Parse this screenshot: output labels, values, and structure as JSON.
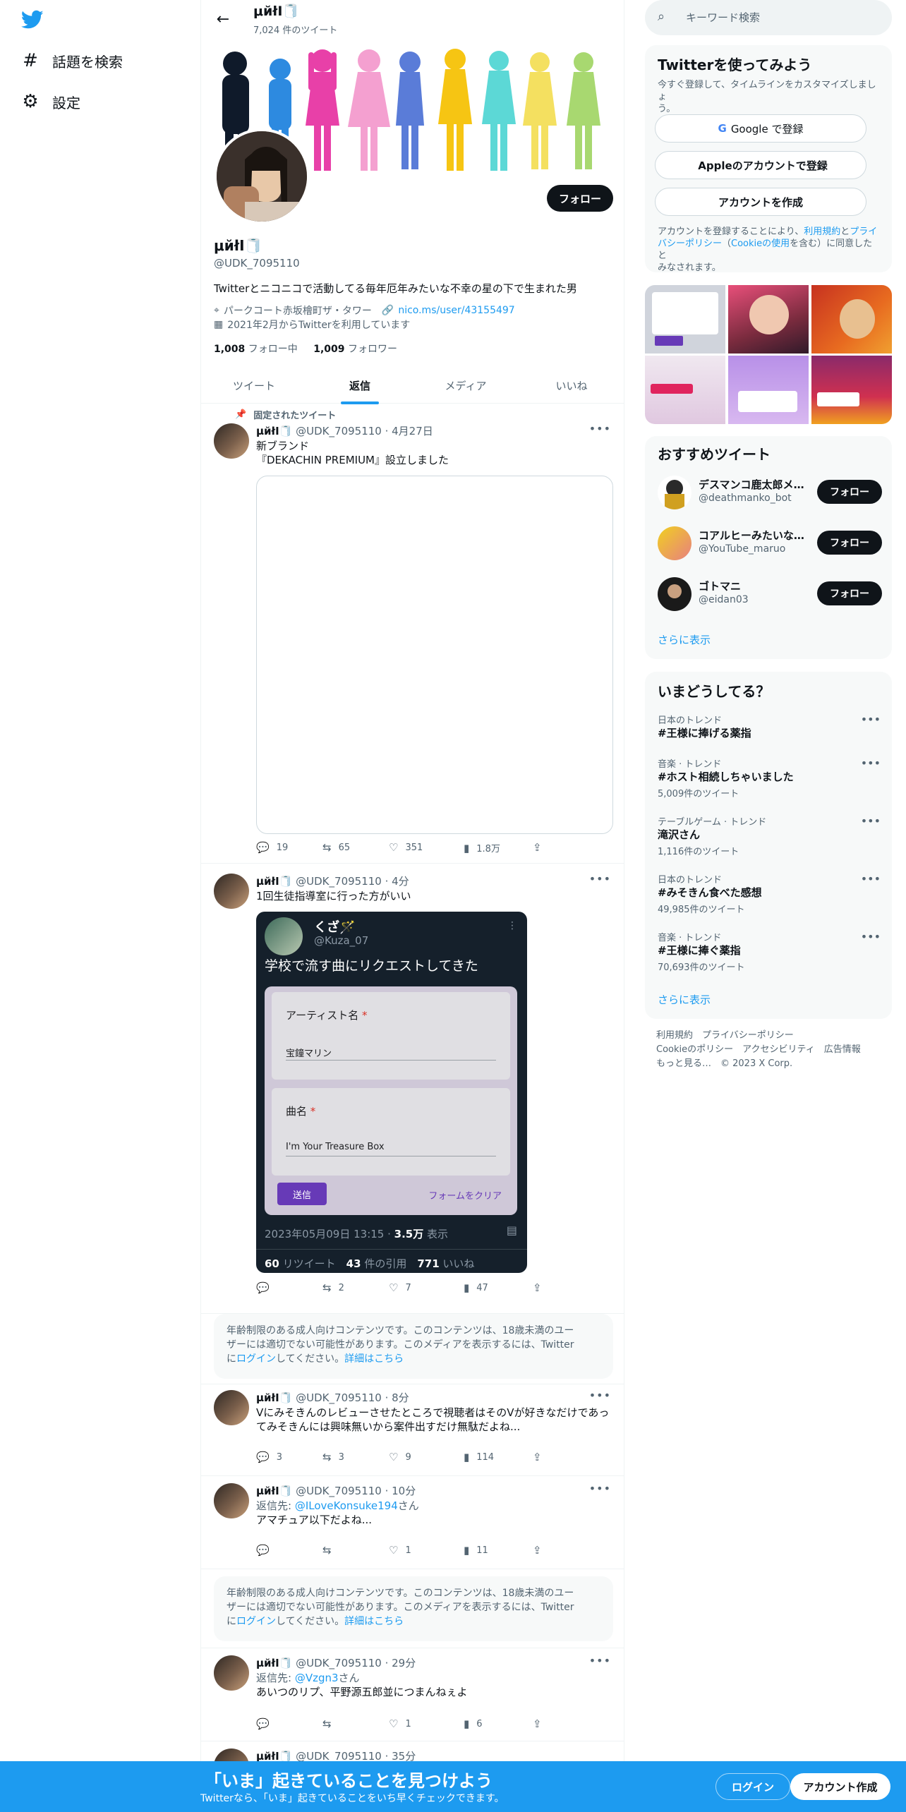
{
  "nav": {
    "explore_label": "話題を検索",
    "settings_label": "設定"
  },
  "profile": {
    "display_name": "μйłI🧻",
    "tweet_count": "7,024 件のツイート",
    "handle": "@UDK_7095110",
    "bio": "Twitterとニコニコで活動してる毎年厄年みたいな不幸の星の下で生まれた男",
    "location": "パークコート赤坂檜町ザ・タワー",
    "link": "nico.ms/user/43155497",
    "joined": "2021年2月からTwitterを利用しています",
    "following_count": "1,008",
    "following_label": "フォロー中",
    "followers_count": "1,009",
    "followers_label": "フォロワー",
    "follow_label": "フォロー"
  },
  "tabs": [
    {
      "label": "ツイート"
    },
    {
      "label": "返信"
    },
    {
      "label": "メディア"
    },
    {
      "label": "いいね"
    }
  ],
  "tweets": [
    {
      "pinned_label": "固定されたツイート",
      "name": "μйłI🧻",
      "handle_time": "@UDK_7095110 · 4月27日",
      "line1": "新ブランド",
      "line2": "『DEKACHIN PREMIUM』設立しました",
      "replies": "19",
      "retweets": "65",
      "likes": "351",
      "views": "1.8万"
    },
    {
      "name": "μйłI🧻",
      "handle_time": "@UDK_7095110 · 4分",
      "line1": "1回生徒指導室に行った方がいい",
      "replies": "",
      "retweets": "2",
      "likes": "7",
      "views": "47",
      "quote": {
        "name": "くざ🪄",
        "handle": "@Kuza_07",
        "text": "学校で流す曲にリクエストしてきた",
        "field1_label": "アーティスト名",
        "field1_value": "宝鐘マリン",
        "field2_label": "曲名",
        "field2_value": "I'm Your Treasure Box",
        "submit_label": "送信",
        "clear_label": "フォームをクリア",
        "meta_date": "2023年05月09日 13:15 · ",
        "meta_views": "3.5万",
        "meta_views_label": " 表示",
        "rt_count": "60",
        "rt_label": " リツイート",
        "quote_count": "43",
        "quote_label": " 件の引用",
        "like_count": "771",
        "like_label": " いいね"
      }
    },
    {
      "name": "μйłI🧻",
      "handle_time": "@UDK_7095110 · 8分",
      "line1": "Vにみそきんのレビューさせたところで視聴者はそのVが好きなだけであっ",
      "line2": "てみそきんには興味無いから案件出すだけ無駄だよね...",
      "replies": "3",
      "retweets": "3",
      "likes": "9",
      "views": "114"
    },
    {
      "name": "μйłI🧻",
      "handle_time": "@UDK_7095110 · 10分",
      "reply_prefix": "返信先: ",
      "reply_to": "@ILoveKonsuke194",
      "reply_suffix": "さん",
      "line1": "アマチュア以下だよね...",
      "replies": "",
      "retweets": "",
      "likes": "1",
      "views": "11"
    },
    {
      "name": "μйłI🧻",
      "handle_time": "@UDK_7095110 · 29分",
      "reply_prefix": "返信先: ",
      "reply_to": "@Vzgn3",
      "reply_suffix": "さん",
      "line1": "あいつのリプ、平野源五郎並につまんねぇよ",
      "replies": "",
      "retweets": "",
      "likes": "1",
      "views": "6"
    },
    {
      "name": "μйłI🧻",
      "handle_time": "@UDK_7095110 · 35分"
    }
  ],
  "warning": {
    "line1": "年齢制限のある成人向けコンテンツです。このコンテンツは、18歳未満のユー",
    "line2": "ザーには適切でない可能性があります。このメディアを表示するには、Twitter",
    "line3_prefix": "に",
    "login_link": "ログイン",
    "line3_mid": "してください。",
    "details_link": "詳細はこちら"
  },
  "right": {
    "search_placeholder": "キーワード検索",
    "signup_panel": {
      "title": "Twitterを使ってみよう",
      "subtitle_line1": "今すぐ登録して、タイムラインをカスタマイズしましょ",
      "subtitle_line2": "う。",
      "google_label": "Google で登録",
      "apple_label": "Appleのアカウントで登録",
      "create_label": "アカウントを作成",
      "terms_1": "アカウントを登録することにより、",
      "terms_link1": "利用規約",
      "terms_2": "と",
      "terms_link2": "プライ",
      "terms_line2_link": "バシーポリシー",
      "terms_line2_mid": "（",
      "terms_link3": "Cookieの使用",
      "terms_line2_end": "を含む）に同意したと",
      "terms_line3": "みなされます。"
    },
    "recommend": {
      "title": "おすすめツイート",
      "users": [
        {
          "name": "デスマンコ鹿太郎メ...",
          "handle": "@deathmanko_bot",
          "follow": "フォロー"
        },
        {
          "name": "コアルヒーみたいな...",
          "handle": "@YouTube_maruo",
          "follow": "フォロー"
        },
        {
          "name": "ゴトマニ",
          "handle": "@eidan03",
          "follow": "フォロー"
        }
      ],
      "show_more": "さらに表示"
    },
    "trends": {
      "title": "いまどうしてる？",
      "items": [
        {
          "context": "日本のトレンド",
          "name": "#王様に捧げる薬指",
          "count": ""
        },
        {
          "context": "音楽 · トレンド",
          "name": "#ホスト相続しちゃいました",
          "count": "5,009件のツイート"
        },
        {
          "context": "テーブルゲーム · トレンド",
          "name": "滝沢さん",
          "count": "1,116件のツイート"
        },
        {
          "context": "日本のトレンド",
          "name": "#みそきん食べた感想",
          "count": "49,985件のツイート"
        },
        {
          "context": "音楽 · トレンド",
          "name": "#王様に捧ぐ薬指",
          "count": "70,693件のツイート"
        }
      ],
      "show_more": "さらに表示"
    },
    "footer": {
      "line1": "利用規約　プライバシーポリシー",
      "line2": "Cookieのポリシー　アクセシビリティ　広告情報",
      "line3": "もっと見る…　© 2023 X Corp."
    }
  },
  "bottom_bar": {
    "title": "「いま」起きていることを見つけよう",
    "subtitle": "Twitterなら、「いま」起きていることをいち早くチェックできます。",
    "login_label": "ログイン",
    "signup_label": "アカウント作成"
  },
  "colors": {
    "accent": "#1d9bf0",
    "text": "#0f1419",
    "secondary": "#536471",
    "quote_card": "#15202b",
    "form_button": "#673ab7"
  }
}
